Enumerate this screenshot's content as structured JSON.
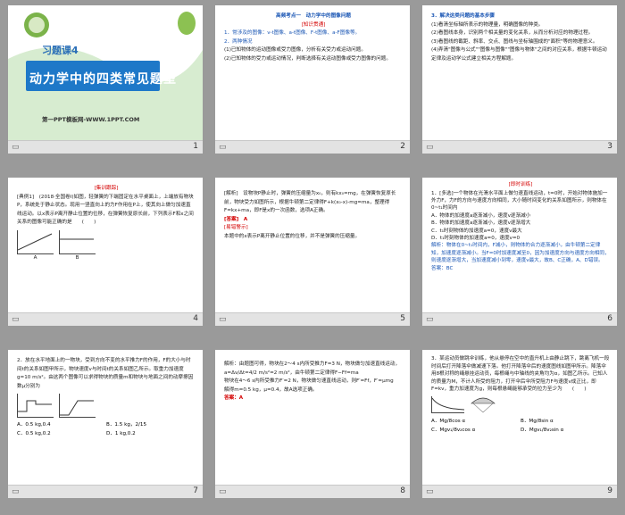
{
  "slides": [
    {
      "num": "1",
      "tag": "习题课4",
      "title": "动力学中的四类常见题型",
      "footer_text": "第一PPT模板网-WWW.1PPT.COM"
    },
    {
      "num": "2",
      "heading": "高频考点一　动力学中的图像问题",
      "sub": "[知识贯通]",
      "lines": [
        "1．常涉及的图像：v-t图像、a-t图像、F-t图像、a-F图像等。",
        "2．两种情况",
        "(1)已知物体的运动图像或受力图像，分析有关受力或运动问题。",
        "(2)已知物体的受力或运动情况，判断选择有关运动图像或受力图像的问题。"
      ]
    },
    {
      "num": "3",
      "lines": [
        "3．解决这类问题的基本步骤",
        "(1)看清坐标轴所表示的物理量，明确图像的种类。",
        "(2)看图线本身，识别两个相关量的变化关系，从而分析对应的物理过程。",
        "(3)看图线的截距、斜率、交点、图线与坐标轴围成的\"面积\"等的物理意义。",
        "(4)弄清\"图像与公式\"\"图像与图像\"\"图像与物体\"之间的对应关系，根据牛顿运动定律及运动学公式建立相关方程解题。"
      ]
    },
    {
      "num": "4",
      "head": "[集训跟踪]",
      "q": "[典例1]　(2018·全国卷Ⅰ)如图，轻弹簧的下端固定在水平桌面上，上端放有物块P，系统处于静止状态。现用一竖直向上的力F作用在P上，使其向上做匀加速直线运动。以x表示P离开静止位置的位移，在弹簧恢复原长前，下列表示F和x之间关系的图像可能正确的是　　(　　)",
      "choices": [
        "A",
        "B",
        "C",
        "D"
      ]
    },
    {
      "num": "5",
      "lines": [
        "[解析]　设物块P静止时，弹簧的压缩量为x₀，则有kx₀=mg，在弹簧恢复原长前，物块受力如图所示，根据牛顿第二定律得F+k(x₀-x)-mg=ma，整理得F=kx+ma，即F是x的一次函数，选项A正确。"
      ],
      "answer": "[答案]　A",
      "warn": "[易错警示]",
      "warn_text": "本题中的x表示P离开静止位置的位移，并不是弹簧的压缩量。"
    },
    {
      "num": "6",
      "head": "[即时训练]",
      "q": "1．[多选]一个物体在光滑水平面上做匀速直线运动，t=0时，开始对物体施加一外力F，力F的方向与速度方向相同，大小随时间变化的关系如图所示，则物体在0~t₁时间内",
      "opts": [
        "A．物体的加速度a逐渐减小，速度v逐渐减小",
        "B．物体的加速度a逐渐减小，速度v逐渐增大",
        "C．t₁时刻物体的加速度a=0，速度v最大",
        "D．t₁时刻物体的加速度a=0，速度v=0"
      ],
      "analysis": "解析：物体在0~t₁时间内，F减小，则物体的合力逐渐减小，由牛顿第二定律知，加速度逐渐减小。当F=0时加速度减至0，因为加速度方向与速度方向相同，则速度逐渐增大，当加速度减小到零，速度v最大，故B、C正确，A、D错误。",
      "answer": "答案：BC"
    },
    {
      "num": "7",
      "q": "2．放在水平地面上的一物块，受到方向不变的水平推力F的作用，F的大小与时间t的关系如图甲所示，物块速度v与时间t的关系如图乙所示。取重力加速度g=10 m/s²。由这两个图像可以求得物块的质量m和物块与地面之间的动摩擦因数μ分别为",
      "opts": [
        "A．0.5 kg,0.4",
        "B．1.5 kg，2/15",
        "C．0.5 kg,0.2",
        "D．1 kg,0.2"
      ]
    },
    {
      "num": "8",
      "lines": [
        "解析：由题图可得，物块在2～4 s内所受推力F=3 N，物块做匀加速直线运动，a=Δv/Δt=4/2 m/s²=2 m/s²，由牛顿第二定律得F−Ff=ma",
        "物块在4～6 s内所受推力F′=2 N，物块做匀速直线运动，则F′=Ff，F′=μmg",
        "解得m=0.5 kg，μ=0.4，故A选项正确。"
      ],
      "answer": "答案：A"
    },
    {
      "num": "9",
      "q": "3．某运动员做跳伞训练，他从悬停在空中的直升机上由静止跳下，跳离飞机一段时间后打开降落伞做减速下落。他打开降落伞后的速度图线如图甲所示。降落伞用8根对称的绳悬挂运动员，每根绳与中轴线的夹角均为α，如图乙所示。已知人的质量为M，不计人所受的阻力，打开伞后伞所受阻力F与速度v成正比，即F=kv，重力加速度为g，则每根悬绳能够承受的拉力至少为　　(　　)",
      "opts": [
        "A．Mg/8cos α",
        "B．Mg/8sin α",
        "C．Mgv₁/8v₂cos α",
        "D．Mgv₁/8v₂sin α"
      ]
    }
  ],
  "colors": {
    "accent_red": "#d40000",
    "accent_blue": "#1a56b4",
    "bg": "#9a9a9a"
  },
  "icons": {
    "footer": "slide-icon"
  }
}
